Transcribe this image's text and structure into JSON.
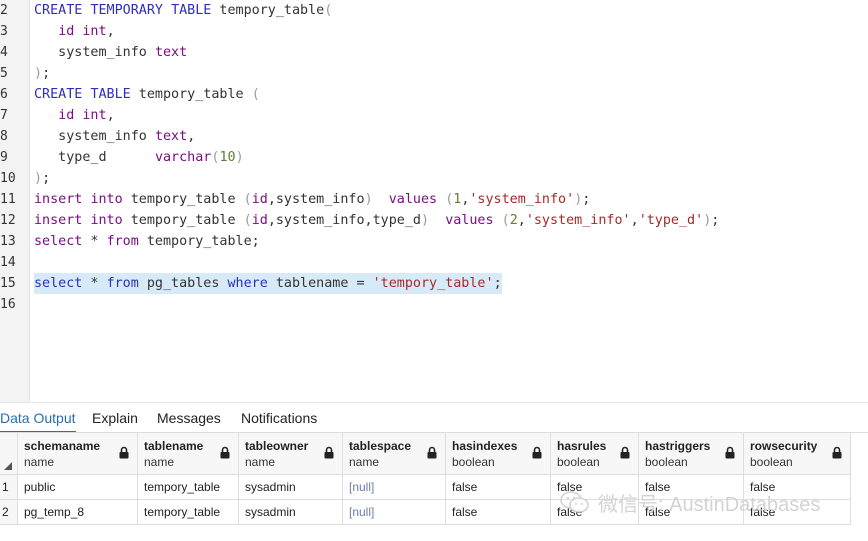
{
  "editor": {
    "lines": [
      {
        "num": "2",
        "tokens": [
          {
            "t": "CREATE",
            "c": "tok-keyword blue"
          },
          {
            "t": " "
          },
          {
            "t": "TEMPORARY",
            "c": "tok-keyword blue"
          },
          {
            "t": " "
          },
          {
            "t": "TABLE",
            "c": "tok-keyword blue"
          },
          {
            "t": " tempory_table"
          },
          {
            "t": "(",
            "c": "tok-paren"
          }
        ]
      },
      {
        "num": "3",
        "tokens": [
          {
            "t": "   "
          },
          {
            "t": "id",
            "c": "tok-keyword"
          },
          {
            "t": " "
          },
          {
            "t": "int",
            "c": "tok-type"
          },
          {
            "t": ","
          }
        ]
      },
      {
        "num": "4",
        "tokens": [
          {
            "t": "   system_info "
          },
          {
            "t": "text",
            "c": "tok-type"
          }
        ]
      },
      {
        "num": "5",
        "tokens": [
          {
            "t": ")",
            "c": "tok-paren"
          },
          {
            "t": ";"
          }
        ]
      },
      {
        "num": "6",
        "tokens": [
          {
            "t": "CREATE",
            "c": "tok-keyword blue"
          },
          {
            "t": " "
          },
          {
            "t": "TABLE",
            "c": "tok-keyword blue"
          },
          {
            "t": " tempory_table "
          },
          {
            "t": "(",
            "c": "tok-paren"
          }
        ]
      },
      {
        "num": "7",
        "tokens": [
          {
            "t": "   "
          },
          {
            "t": "id",
            "c": "tok-keyword"
          },
          {
            "t": " "
          },
          {
            "t": "int",
            "c": "tok-type"
          },
          {
            "t": ","
          }
        ]
      },
      {
        "num": "8",
        "tokens": [
          {
            "t": "   system_info "
          },
          {
            "t": "text",
            "c": "tok-type"
          },
          {
            "t": ","
          }
        ]
      },
      {
        "num": "9",
        "tokens": [
          {
            "t": "   type_d      "
          },
          {
            "t": "varchar",
            "c": "tok-type"
          },
          {
            "t": "(",
            "c": "tok-paren"
          },
          {
            "t": "10",
            "c": "tok-number"
          },
          {
            "t": ")",
            "c": "tok-paren"
          }
        ]
      },
      {
        "num": "10",
        "tokens": [
          {
            "t": ")",
            "c": "tok-paren"
          },
          {
            "t": ";"
          }
        ]
      },
      {
        "num": "11",
        "tokens": [
          {
            "t": "insert",
            "c": "tok-keyword"
          },
          {
            "t": " "
          },
          {
            "t": "into",
            "c": "tok-keyword"
          },
          {
            "t": " tempory_table "
          },
          {
            "t": "(",
            "c": "tok-paren"
          },
          {
            "t": "id",
            "c": "tok-keyword"
          },
          {
            "t": ",system_info"
          },
          {
            "t": ")",
            "c": "tok-paren"
          },
          {
            "t": "  "
          },
          {
            "t": "values",
            "c": "tok-keyword"
          },
          {
            "t": " "
          },
          {
            "t": "(",
            "c": "tok-paren"
          },
          {
            "t": "1",
            "c": "tok-number"
          },
          {
            "t": ","
          },
          {
            "t": "'system_info'",
            "c": "tok-string"
          },
          {
            "t": ")",
            "c": "tok-paren"
          },
          {
            "t": ";"
          }
        ]
      },
      {
        "num": "12",
        "tokens": [
          {
            "t": "insert",
            "c": "tok-keyword"
          },
          {
            "t": " "
          },
          {
            "t": "into",
            "c": "tok-keyword"
          },
          {
            "t": " tempory_table "
          },
          {
            "t": "(",
            "c": "tok-paren"
          },
          {
            "t": "id",
            "c": "tok-keyword"
          },
          {
            "t": ",system_info,type_d"
          },
          {
            "t": ")",
            "c": "tok-paren"
          },
          {
            "t": "  "
          },
          {
            "t": "values",
            "c": "tok-keyword"
          },
          {
            "t": " "
          },
          {
            "t": "(",
            "c": "tok-paren"
          },
          {
            "t": "2",
            "c": "tok-number"
          },
          {
            "t": ","
          },
          {
            "t": "'system_info'",
            "c": "tok-string"
          },
          {
            "t": ","
          },
          {
            "t": "'type_d'",
            "c": "tok-string"
          },
          {
            "t": ")",
            "c": "tok-paren"
          },
          {
            "t": ";"
          }
        ]
      },
      {
        "num": "13",
        "tokens": [
          {
            "t": "select",
            "c": "tok-keyword"
          },
          {
            "t": " * "
          },
          {
            "t": "from",
            "c": "tok-keyword"
          },
          {
            "t": " tempory_table;"
          }
        ]
      },
      {
        "num": "14",
        "tokens": []
      },
      {
        "num": "15",
        "highlight": true,
        "tokens": [
          {
            "t": "select",
            "c": "tok-keyword blue"
          },
          {
            "t": " * "
          },
          {
            "t": "from",
            "c": "tok-keyword blue"
          },
          {
            "t": " pg_tables "
          },
          {
            "t": "where",
            "c": "tok-keyword blue"
          },
          {
            "t": " tablename = "
          },
          {
            "t": "'tempory_table'",
            "c": "tok-string"
          },
          {
            "t": ";"
          }
        ]
      },
      {
        "num": "16",
        "tokens": []
      }
    ]
  },
  "tabs": [
    {
      "label": "Data Output",
      "active": true
    },
    {
      "label": "Explain",
      "active": false
    },
    {
      "label": "Messages",
      "active": false
    },
    {
      "label": "Notifications",
      "active": false
    }
  ],
  "grid": {
    "columns": [
      {
        "name": "schemaname",
        "type": "name"
      },
      {
        "name": "tablename",
        "type": "name"
      },
      {
        "name": "tableowner",
        "type": "name"
      },
      {
        "name": "tablespace",
        "type": "name"
      },
      {
        "name": "hasindexes",
        "type": "boolean"
      },
      {
        "name": "hasrules",
        "type": "boolean"
      },
      {
        "name": "hastriggers",
        "type": "boolean"
      },
      {
        "name": "rowsecurity",
        "type": "boolean"
      }
    ],
    "rows": [
      {
        "num": "1",
        "cells": [
          "public",
          "tempory_table",
          "sysadmin",
          "[null]",
          "false",
          "false",
          "false",
          "false"
        ]
      },
      {
        "num": "2",
        "cells": [
          "pg_temp_8",
          "tempory_table",
          "sysadmin",
          "[null]",
          "false",
          "false",
          "false",
          "false"
        ]
      }
    ]
  },
  "watermark": {
    "text": "微信号: AustinDatabases",
    "icon": "wechat-icon"
  }
}
